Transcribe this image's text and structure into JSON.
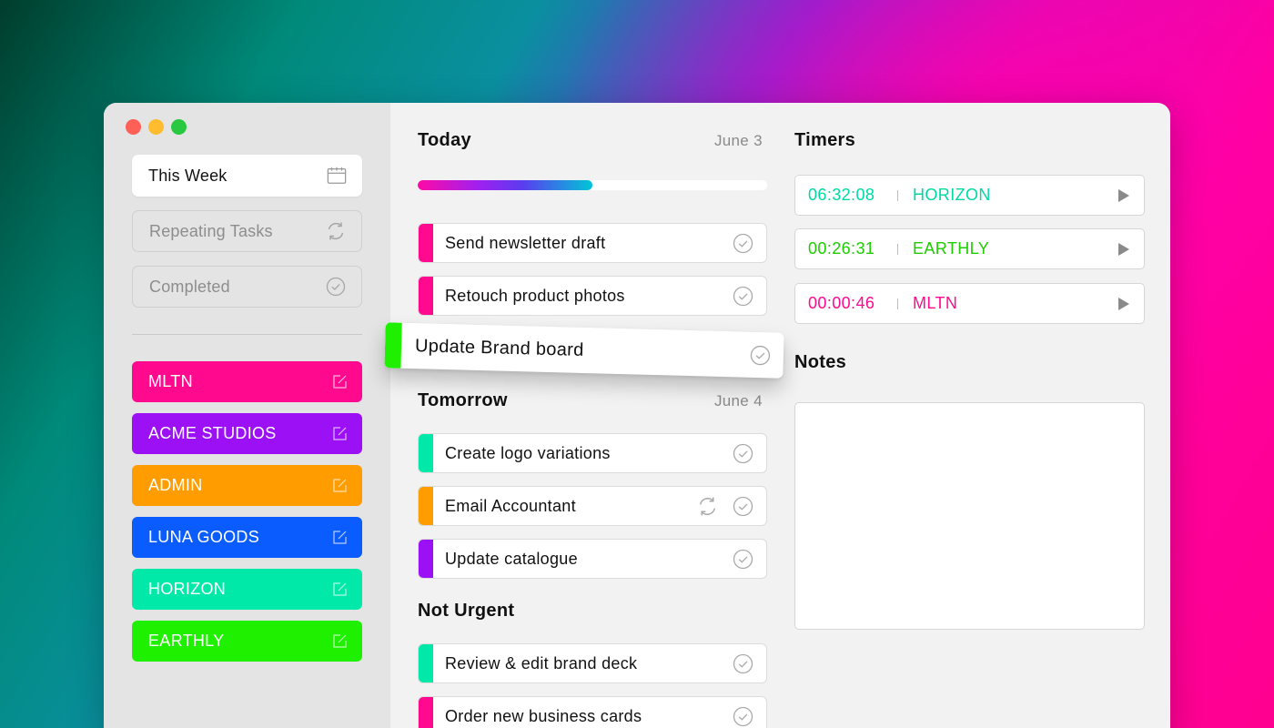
{
  "colors": {
    "pink": "#ff0a8e",
    "purple": "#9b10f5",
    "orange": "#ff9c00",
    "blue": "#0a5cff",
    "teal": "#00e9a8",
    "green": "#1ff000",
    "timer_teal": "#00d8a4",
    "timer_green": "#1ecc00",
    "timer_pink": "#ff0a8e"
  },
  "sidebar": {
    "nav": [
      {
        "label": "This Week",
        "icon": "calendar-icon"
      },
      {
        "label": "Repeating Tasks",
        "icon": "repeat-icon"
      },
      {
        "label": "Completed",
        "icon": "check-circle-icon"
      }
    ],
    "projects": [
      {
        "label": "MLTN",
        "color": "#ff0a8e"
      },
      {
        "label": "ACME STUDIOS",
        "color": "#9b10f5"
      },
      {
        "label": "ADMIN",
        "color": "#ff9c00"
      },
      {
        "label": "LUNA GOODS",
        "color": "#0a5cff"
      },
      {
        "label": "HORIZON",
        "color": "#00e9a8"
      },
      {
        "label": "EARTHLY",
        "color": "#1ff000"
      }
    ]
  },
  "today": {
    "title": "Today",
    "date": "June 3",
    "progress": 0.5,
    "tasks": [
      {
        "label": "Send newsletter draft",
        "color": "#ff0a8e"
      },
      {
        "label": "Retouch product photos",
        "color": "#ff0a8e"
      }
    ]
  },
  "dragging_task": {
    "label": "Update Brand board",
    "color": "#1ff000"
  },
  "tomorrow": {
    "title": "Tomorrow",
    "date": "June 4",
    "tasks": [
      {
        "label": "Create logo variations",
        "color": "#00e9a8"
      },
      {
        "label": "Email Accountant",
        "color": "#ff9c00",
        "repeating": true
      },
      {
        "label": "Update catalogue",
        "color": "#9b10f5"
      }
    ]
  },
  "not_urgent": {
    "title": "Not Urgent",
    "tasks": [
      {
        "label": "Review & edit brand deck",
        "color": "#00e9a8"
      },
      {
        "label": "Order new business cards",
        "color": "#ff0a8e"
      }
    ]
  },
  "timers": {
    "title": "Timers",
    "items": [
      {
        "time": "06:32:08",
        "project": "HORIZON",
        "color": "#00d8a4"
      },
      {
        "time": "00:26:31",
        "project": "EARTHLY",
        "color": "#1ecc00"
      },
      {
        "time": "00:00:46",
        "project": "MLTN",
        "color": "#ff0a8e"
      }
    ]
  },
  "notes": {
    "title": "Notes"
  }
}
